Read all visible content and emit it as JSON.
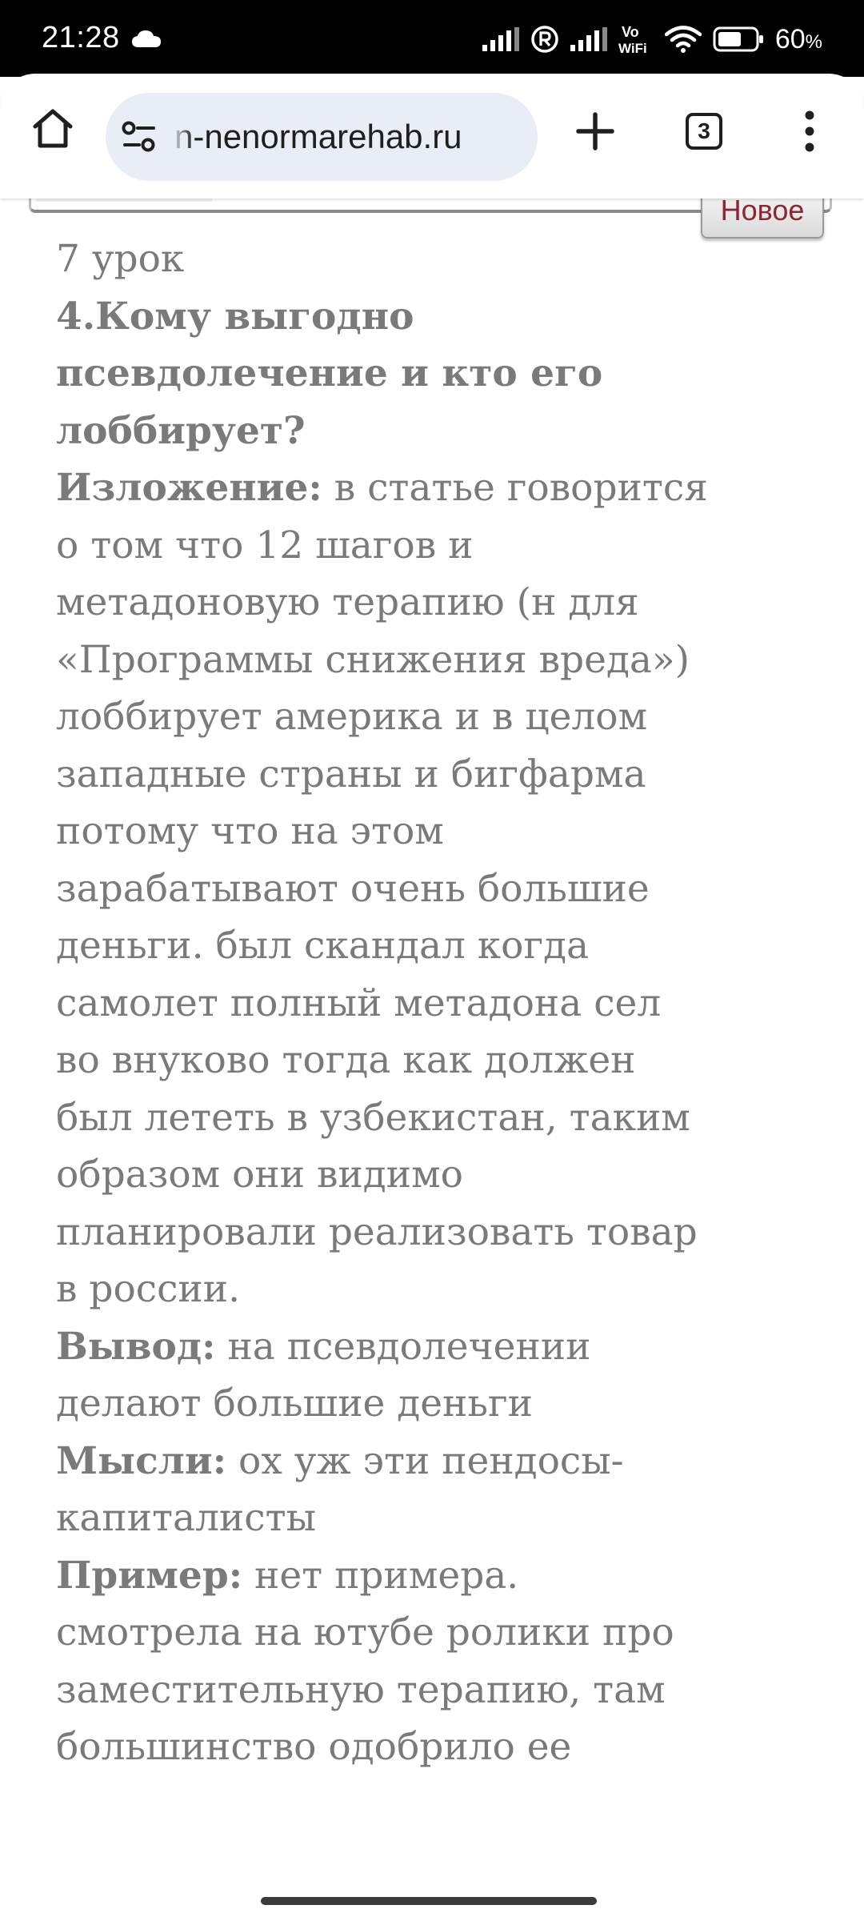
{
  "status_bar": {
    "time": "21:28",
    "battery_percent": "60",
    "battery_unit": "%",
    "vowifi_top": "Vo",
    "vowifi_bottom": "WiFi"
  },
  "browser": {
    "url": "n-nenormarehab.ru",
    "tab_count": "3"
  },
  "page": {
    "badge": "Новое",
    "lesson": "7 урок",
    "heading": "4.Кому выгодно псевдолечение и кто его лоббирует?",
    "summary_label": "Изложение:",
    "summary_text": " в статье говорится о том что 12 шагов и метадоновую терапию (н для «Программы снижения вреда») лоббирует америка и в целом западные страны и бигфарма потому что на этом зарабатывают очень большие деньги. был скандал когда самолет полный метадона сел во внуково тогда как должен был лететь в узбекистан, таким образом они видимо планировали реализовать товар в россии.",
    "conclusion_label": "Вывод:",
    "conclusion_text": " на псевдолечении делают большие деньги",
    "thoughts_label": "Мысли:",
    "thoughts_text": " ох уж эти пендосы-капиталисты",
    "example_label": "Пример:",
    "example_text": " нет примера. смотрела на ютубе ролики про заместительную терапию, там большинство одобрило ее"
  },
  "colors": {
    "status_bar_bg": "#000000",
    "url_pill_bg": "#e8edf6",
    "article_text": "#7a7a7a",
    "badge_text": "#8b2635"
  },
  "icons": [
    "cloud-icon",
    "signal-icon",
    "registered-icon",
    "vowifi-icon",
    "wifi-icon",
    "battery-icon",
    "home-icon",
    "site-settings-icon",
    "plus-icon",
    "kebab-menu-icon"
  ]
}
